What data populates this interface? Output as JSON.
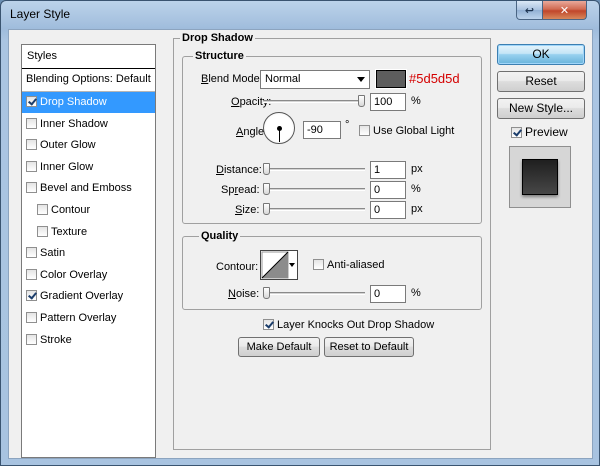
{
  "window": {
    "title": "Layer Style",
    "help_icon": "help-icon",
    "close_icon": "close-icon"
  },
  "styles_panel": {
    "header": "Styles",
    "items": [
      {
        "label": "Blending Options: Default",
        "checkbox": false,
        "checked": false,
        "selected": false,
        "indent": false
      },
      {
        "label": "Drop Shadow",
        "checkbox": true,
        "checked": true,
        "selected": true,
        "indent": false
      },
      {
        "label": "Inner Shadow",
        "checkbox": true,
        "checked": false,
        "selected": false,
        "indent": false
      },
      {
        "label": "Outer Glow",
        "checkbox": true,
        "checked": false,
        "selected": false,
        "indent": false
      },
      {
        "label": "Inner Glow",
        "checkbox": true,
        "checked": false,
        "selected": false,
        "indent": false
      },
      {
        "label": "Bevel and Emboss",
        "checkbox": true,
        "checked": false,
        "selected": false,
        "indent": false
      },
      {
        "label": "Contour",
        "checkbox": true,
        "checked": false,
        "selected": false,
        "indent": true
      },
      {
        "label": "Texture",
        "checkbox": true,
        "checked": false,
        "selected": false,
        "indent": true
      },
      {
        "label": "Satin",
        "checkbox": true,
        "checked": false,
        "selected": false,
        "indent": false
      },
      {
        "label": "Color Overlay",
        "checkbox": true,
        "checked": false,
        "selected": false,
        "indent": false
      },
      {
        "label": "Gradient Overlay",
        "checkbox": true,
        "checked": true,
        "selected": false,
        "indent": false
      },
      {
        "label": "Pattern Overlay",
        "checkbox": true,
        "checked": false,
        "selected": false,
        "indent": false
      },
      {
        "label": "Stroke",
        "checkbox": true,
        "checked": false,
        "selected": false,
        "indent": false
      }
    ]
  },
  "drop_shadow": {
    "title": "Drop Shadow",
    "structure": {
      "title": "Structure",
      "blend_mode_label": "Blend Mode:",
      "blend_mode_value": "Normal",
      "shadow_color": "#5d5d5d",
      "shadow_color_text": "#5d5d5d",
      "opacity_label": "Opacity:",
      "opacity_value": "100",
      "opacity_level": 1.0,
      "opacity_unit": "%",
      "angle_label": "Angle:",
      "angle_value": "-90",
      "angle_degrees": -90,
      "angle_unit": "°",
      "global_light_label": "Use Global Light",
      "global_light_checked": false,
      "distance_label": "Distance:",
      "distance_value": "1",
      "distance_level": 0.0,
      "distance_unit": "px",
      "spread_label": "Spread:",
      "spread_value": "0",
      "spread_level": 0.0,
      "spread_unit": "%",
      "size_label": "Size:",
      "size_value": "0",
      "size_level": 0.0,
      "size_unit": "px"
    },
    "quality": {
      "title": "Quality",
      "contour_label": "Contour:",
      "anti_aliased_label": "Anti-aliased",
      "anti_aliased_checked": false,
      "noise_label": "Noise:",
      "noise_value": "0",
      "noise_level": 0.0,
      "noise_unit": "%"
    },
    "knockout_label": "Layer Knocks Out Drop Shadow",
    "knockout_checked": true,
    "make_default_label": "Make Default",
    "reset_default_label": "Reset to Default"
  },
  "actions": {
    "ok_label": "OK",
    "reset_label": "Reset",
    "new_style_label": "New Style...",
    "preview_label": "Preview",
    "preview_checked": true
  },
  "colors": {
    "selection": "#3399ff",
    "hex_text": "#d40000"
  }
}
